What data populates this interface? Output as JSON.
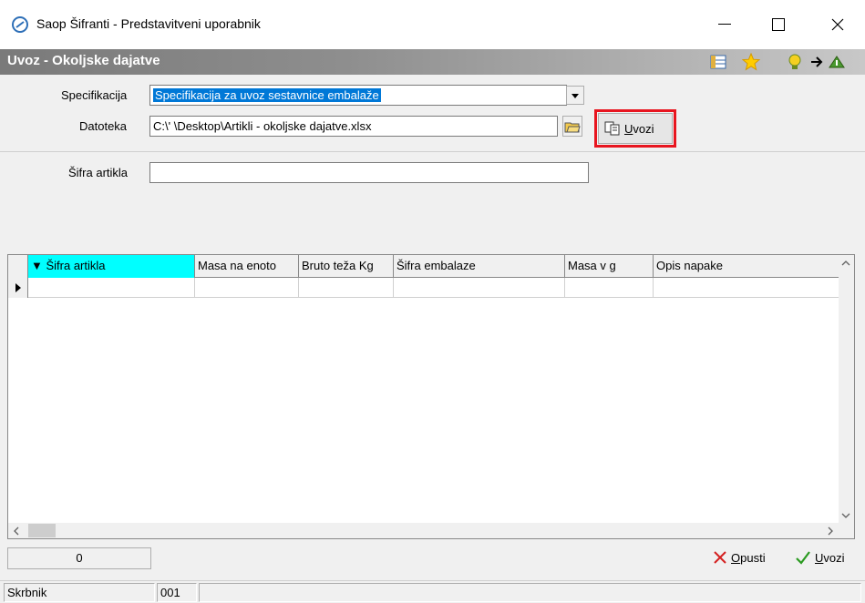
{
  "window": {
    "title": "Saop Šifranti - Predstavitveni uporabnik"
  },
  "header": {
    "title": "Uvoz - Okoljske dajatve"
  },
  "form": {
    "spec_label": "Specifikacija",
    "spec_value": "Specifikacija za uvoz sestavnice embalaže",
    "file_label": "Datoteka",
    "file_value": "C:\\'                         \\Desktop\\Artikli - okoljske dajatve.xlsx",
    "import_label": "Uvozi",
    "import_hotkey": "U",
    "import_rest": "vozi",
    "sifra_label": "Šifra artikla",
    "sifra_value": ""
  },
  "grid": {
    "columns": [
      {
        "label": "▼ Šifra artikla",
        "width": 183
      },
      {
        "label": "Masa na enoto",
        "width": 114
      },
      {
        "label": "Bruto teža Kg",
        "width": 104
      },
      {
        "label": "Šifra embalaze",
        "width": 188
      },
      {
        "label": "Masa v g",
        "width": 97
      },
      {
        "label": "Opis napake",
        "width": 204
      }
    ]
  },
  "footer": {
    "count": "0",
    "cancel_hotkey": "O",
    "cancel_rest": "pusti",
    "confirm_hotkey": "U",
    "confirm_rest": "vozi"
  },
  "status": {
    "user": "Skrbnik",
    "code": "001"
  },
  "colors": {
    "accent": "#0078d7",
    "highlight": "#e8151f",
    "active_column": "#00ffff"
  }
}
